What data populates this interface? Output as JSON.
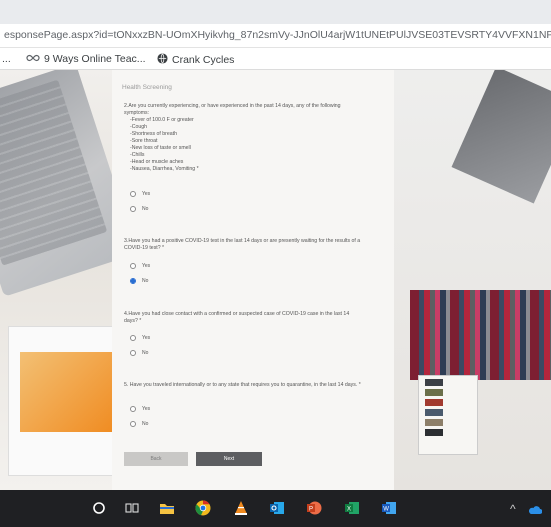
{
  "browser": {
    "url": "esponsePage.aspx?id=tONxxzBN-UOmXHyikvhg_87n2smVy-JJnOlU4arjW1tUNEtPUlJVSE03TEVSRTY4VVFXN1NPUFpIUS4",
    "bookmarks_overflow": "...",
    "bookmarks": [
      {
        "label": "9 Ways Online Teac...",
        "icon": "link-infinity-icon"
      },
      {
        "label": "Crank Cycles",
        "icon": "globe-icon"
      }
    ]
  },
  "form": {
    "section_title": "Health Screening",
    "questions": [
      {
        "text": "2.Are you currently experiencing, or have experienced in the past 14 days, any of the following symptoms:",
        "symptoms": [
          "-Fever of 100.0 F or greater",
          "-Cough",
          "-Shortness of breath",
          "-Sore throat",
          "-New loss of taste or smell",
          "-Chills",
          "-Head or muscle aches",
          "-Nausea, Diarrhea, Vomiting *"
        ],
        "options": [
          "Yes",
          "No"
        ],
        "selected": null
      },
      {
        "text": "3.Have you had a positive COVID-19 test in the last 14 days or are presently waiting for the results of a COVID-19 test? *",
        "options": [
          "Yes",
          "No"
        ],
        "selected": "No"
      },
      {
        "text": "4.Have you had close contact with a confirmed or suspected case of COVID-19 case in the last 14 days? *",
        "options": [
          "Yes",
          "No"
        ],
        "selected": null
      },
      {
        "text": "5. Have you traveled internationally or to any state that requires you to quarantine, in the last 14 days. *",
        "options": [
          "Yes",
          "No"
        ],
        "selected": null
      }
    ],
    "buttons": {
      "back": "Back",
      "next": "Next"
    }
  },
  "taskbar": {
    "apps": [
      "search-icon",
      "task-view-icon",
      "file-explorer-icon",
      "chrome-icon",
      "vlc-icon",
      "outlook-icon",
      "powerpoint-icon",
      "excel-icon",
      "word-icon"
    ],
    "tray_chevron": "^"
  },
  "colors": {
    "accent": "#2b6ed1",
    "next_button": "#5d5e61",
    "taskbar": "#1f2023"
  }
}
